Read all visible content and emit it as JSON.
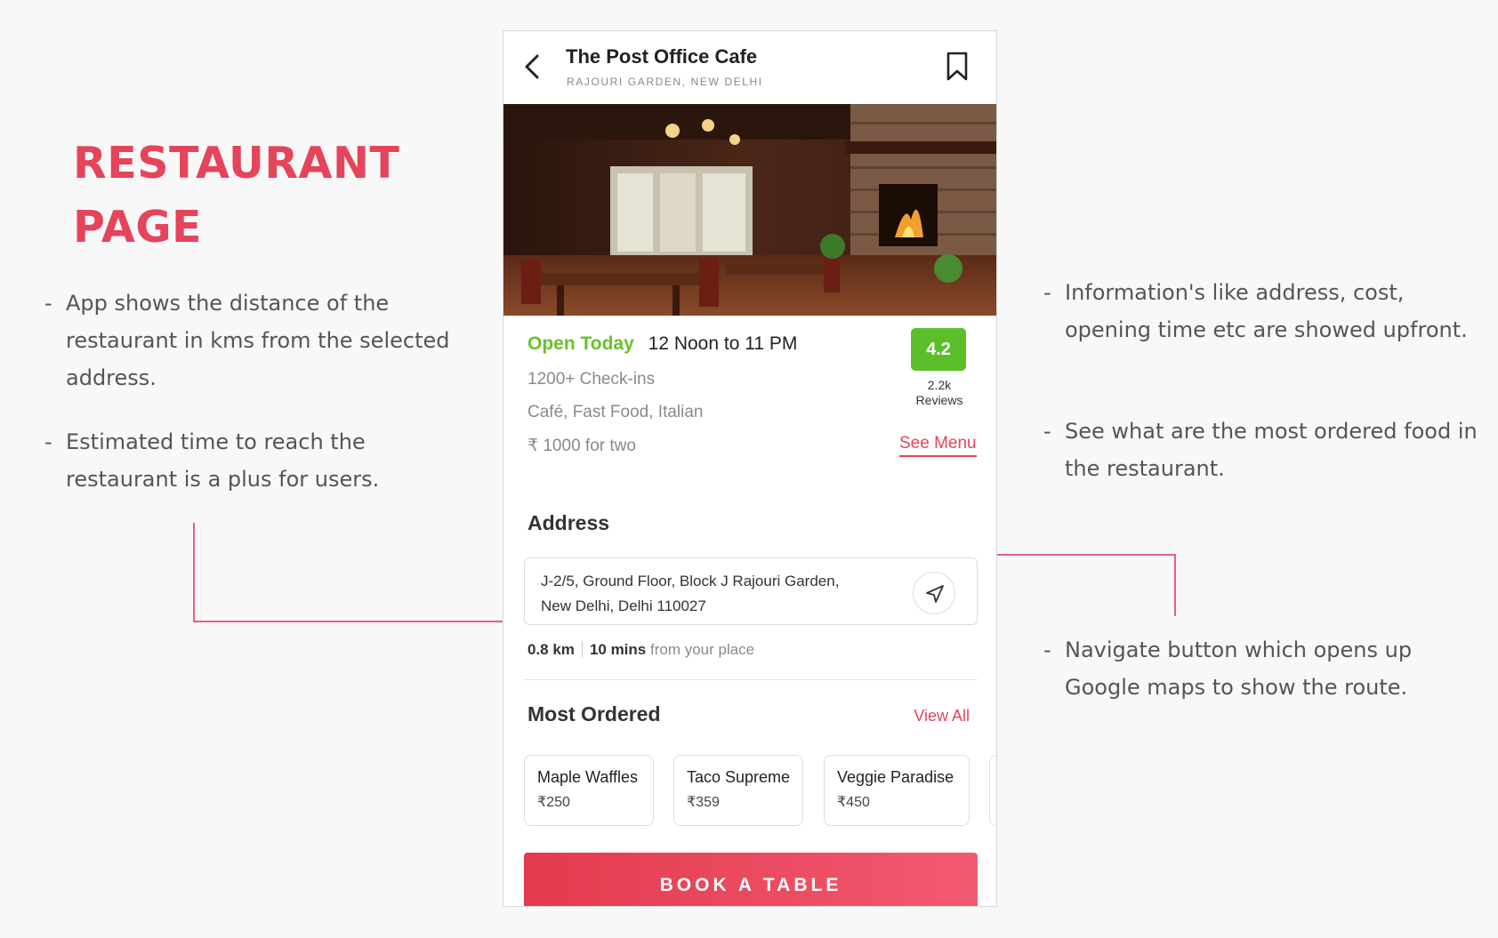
{
  "annotation": {
    "title_line1": "RESTAURANT",
    "title_line2": "PAGE",
    "dash": "-",
    "left_notes": [
      "App shows the distance of the restaurant in kms from the selected address.",
      "Estimated time to reach the restaurant is a plus for users."
    ],
    "right_notes": [
      "Information's like address, cost, opening time etc are showed upfront.",
      "See what are the most ordered food in the restaurant.",
      "Navigate button which opens up Google maps to show the route."
    ],
    "accent_color": "#e5445a"
  },
  "header": {
    "back_icon": "chevron-left-icon",
    "title": "The Post Office Cafe",
    "location": "RAJOURI GARDEN, NEW DELHI",
    "bookmark_icon": "bookmark-icon"
  },
  "hero_image": {
    "description_icon": "restaurant-interior-photo"
  },
  "info": {
    "open_status": "Open Today",
    "hours": "12 Noon to 11 PM",
    "checkins": "1200+ Check-ins",
    "cuisines": "Café, Fast Food, Italian",
    "cost": "₹ 1000 for two",
    "rating": "4.2",
    "reviews_count": "2.2k",
    "reviews_label": "Reviews",
    "see_menu": "See Menu",
    "rating_color": "#5bbf2a",
    "open_color": "#6ac02c"
  },
  "address": {
    "title": "Address",
    "line1": "J-2/5, Ground Floor, Block J Rajouri Garden,",
    "line2": "New Delhi, Delhi 110027",
    "navigate_icon": "navigation-arrow-icon",
    "distance": "0.8 km",
    "time": "10 mins",
    "from_text": "from your place"
  },
  "most_ordered": {
    "title": "Most Ordered",
    "view_all": "View All",
    "items": [
      {
        "name": "Maple Waffles",
        "price": "₹250"
      },
      {
        "name": "Taco Supreme",
        "price": "₹359"
      },
      {
        "name": "Veggie Paradise",
        "price": "₹450"
      }
    ]
  },
  "cta": {
    "label": "BOOK A TABLE",
    "gradient_start": "#e33a4f",
    "gradient_end": "#f25a70"
  }
}
